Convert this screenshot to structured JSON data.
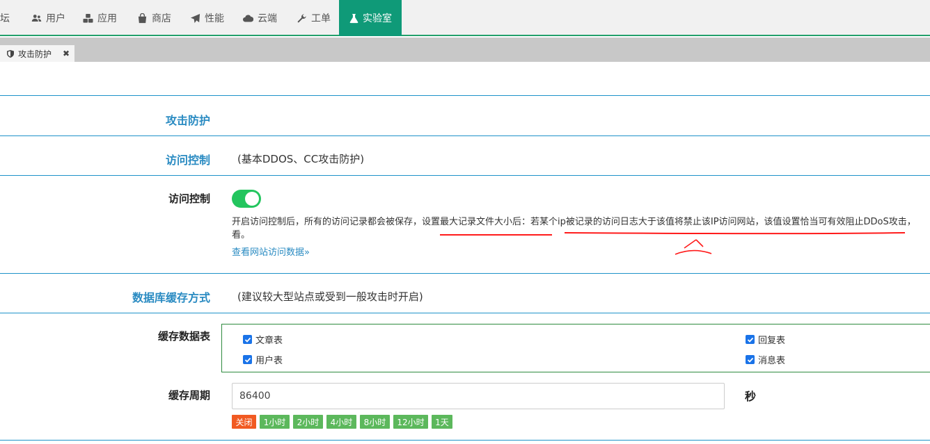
{
  "colors": {
    "accent": "#0f9a78",
    "title_blue": "#2a8bc2",
    "toggle_on": "#23c55e",
    "preset_green": "#5cb85c",
    "preset_red": "#f15a22",
    "annotation": "#ff0000"
  },
  "topnav": {
    "items": [
      {
        "label": "坛",
        "icon": "none"
      },
      {
        "label": "用户",
        "icon": "users-icon"
      },
      {
        "label": "应用",
        "icon": "cubes-icon"
      },
      {
        "label": "商店",
        "icon": "shopping-bag-icon"
      },
      {
        "label": "性能",
        "icon": "paper-plane-icon"
      },
      {
        "label": "云端",
        "icon": "cloud-icon"
      },
      {
        "label": "工单",
        "icon": "wrench-icon"
      },
      {
        "label": "实验室",
        "icon": "flask-icon",
        "active": true
      }
    ]
  },
  "tabs": [
    {
      "label": "攻击防护",
      "icon": "shield-icon",
      "close": "✖"
    }
  ],
  "sections": {
    "attack": {
      "title": "攻击防护"
    },
    "access": {
      "title": "访问控制",
      "note": "(基本DDOS、CC攻击防护)"
    },
    "access_toggle": {
      "label": "访问控制",
      "enabled": true,
      "description_line1": "开启访问控制后，所有的访问记录都会被保存，设置最大记录文件大小后：若某个ip被记录的访问日志大于该值将禁止该IP访问网站，该值设置恰当可有效阻止DDoS攻击，",
      "description_line2": "看。",
      "link": "查看网站访问数据»"
    },
    "db_cache": {
      "title": "数据库缓存方式",
      "note": "(建议较大型站点或受到一般攻击时开启)"
    },
    "cache_tables": {
      "label": "缓存数据表",
      "options": [
        {
          "label": "文章表",
          "checked": true
        },
        {
          "label": "回复表",
          "checked": true
        },
        {
          "label": "用户表",
          "checked": true
        },
        {
          "label": "消息表",
          "checked": true
        }
      ]
    },
    "cache_period": {
      "label": "缓存周期",
      "value": "86400",
      "unit": "秒",
      "presets": [
        "关闭",
        "1小时",
        "2小时",
        "4小时",
        "8小时",
        "12小时",
        "1天"
      ]
    }
  }
}
